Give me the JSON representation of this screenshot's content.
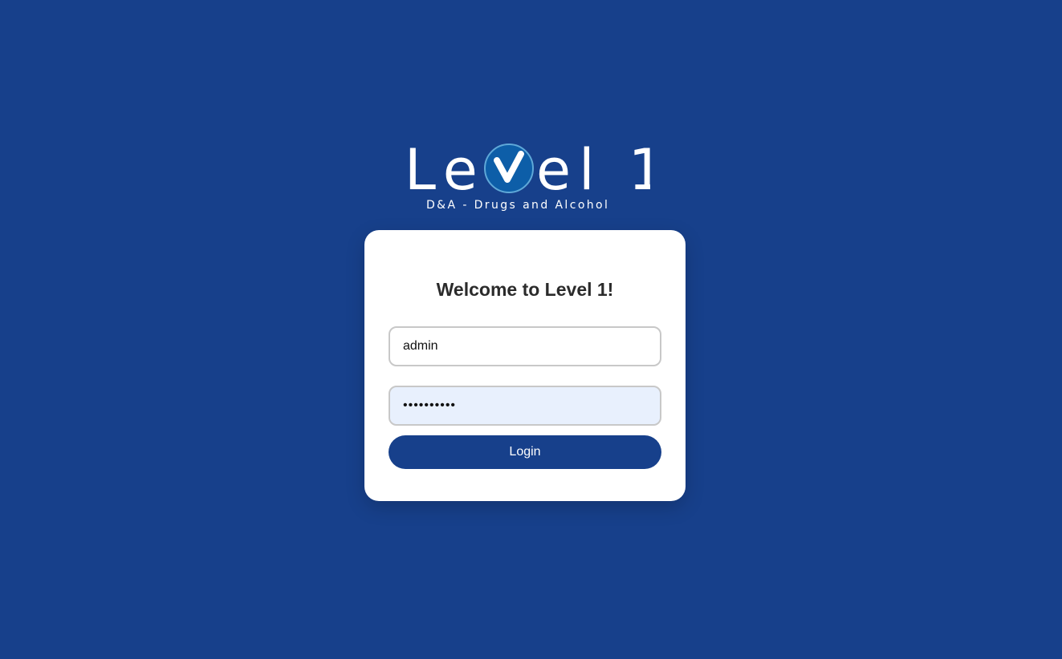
{
  "logo": {
    "title": "Level 1",
    "title_left": "Le",
    "title_right": "el 1",
    "tagline": "D&A - Drugs and Alcohol",
    "check_icon": "check-circle-icon",
    "check_circle_color": "#0d5ea8"
  },
  "login": {
    "heading": "Welcome to Level 1!",
    "username_value": "admin",
    "password_value": "••••••••••",
    "button_label": "Login"
  },
  "colors": {
    "background": "#17408b",
    "card": "#ffffff",
    "button": "#17408b",
    "autofill": "#e8f0fd"
  }
}
